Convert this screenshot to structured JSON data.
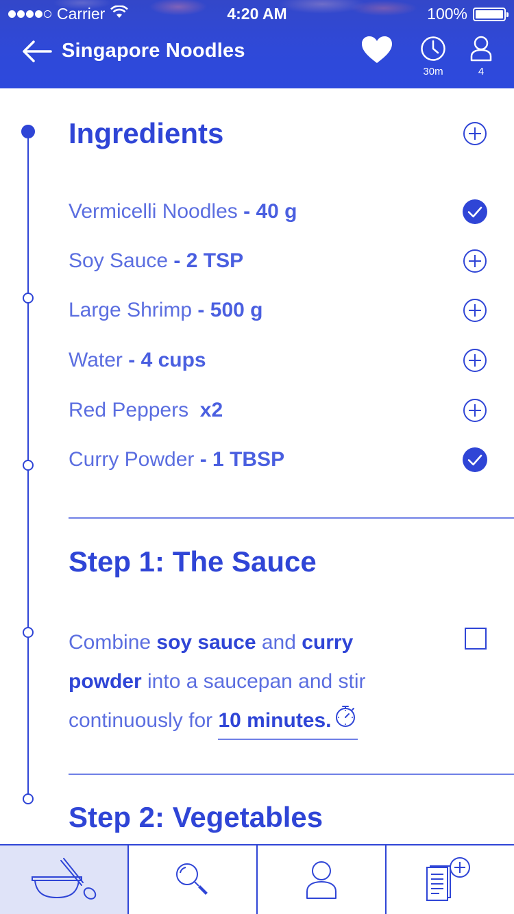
{
  "status_bar": {
    "carrier": "Carrier",
    "time": "4:20 AM",
    "battery": "100%"
  },
  "nav": {
    "title": "Singapore Noodles",
    "time_label": "30m",
    "servings_label": "4"
  },
  "ingredients": {
    "title": "Ingredients",
    "items": [
      {
        "name": "Vermicelli Noodles",
        "qty": " - 40 g",
        "checked": true
      },
      {
        "name": "Soy Sauce",
        "qty": " - 2 TSP",
        "checked": false
      },
      {
        "name": "Large Shrimp",
        "qty": " - 500 g",
        "checked": false
      },
      {
        "name": "Water",
        "qty": " - 4 cups",
        "checked": false
      },
      {
        "name": "Red Peppers",
        "qty": "  x2",
        "checked": false
      },
      {
        "name": "Curry Powder",
        "qty": " - 1 TBSP",
        "checked": true
      }
    ]
  },
  "step1": {
    "title": "Step 1: The Sauce",
    "text_1": "Combine ",
    "bold_1": "soy sauce",
    "text_2": " and ",
    "bold_2": "curry powder",
    "text_3": " into a saucepan and stir continuously for ",
    "timer": "10 minutes."
  },
  "step2": {
    "title": "Step 2: Vegetables"
  },
  "tabs": [
    {
      "icon": "bowl-spoon-icon",
      "active": true
    },
    {
      "icon": "search-icon",
      "active": false
    },
    {
      "icon": "profile-icon",
      "active": false
    },
    {
      "icon": "add-list-icon",
      "active": false
    }
  ],
  "colors": {
    "primary": "#2f45d6",
    "text_light": "#5b6ee0",
    "active_tab_bg": "#dfe3f8"
  }
}
